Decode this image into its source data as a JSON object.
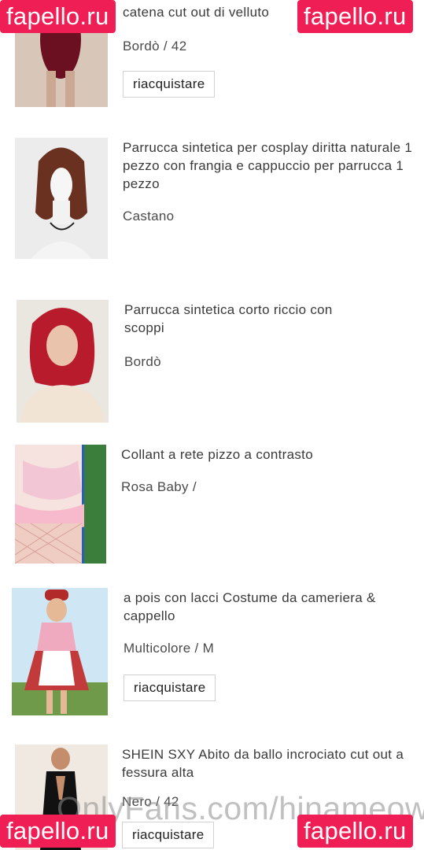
{
  "watermarks": {
    "badge_text": "fapello.ru",
    "site_text": "OnlyFans.com/hinameow",
    "badge_color": "#ef1e54"
  },
  "items": [
    {
      "title": "catena cut out di velluto",
      "variant": "Bordò / 42",
      "rebuy_label": "riacquistare",
      "thumb_colors": [
        "#d8c6b8",
        "#6b1020"
      ]
    },
    {
      "title": "Parrucca sintetica per cosplay diritta naturale 1 pezzo con frangia e cappuccio per parrucca 1 pezzo",
      "variant": "Castano",
      "thumb_colors": [
        "#ececec",
        "#6a3020"
      ]
    },
    {
      "title": "Parrucca sintetica corto riccio con scoppi",
      "variant": "Bordò",
      "thumb_colors": [
        "#eae6e0",
        "#b81c2c"
      ]
    },
    {
      "title": "Collant a rete pizzo a contrasto",
      "variant": "Rosa Baby /",
      "thumb_colors": [
        "#f3c6d6",
        "#2a5fb8"
      ]
    },
    {
      "title": "a pois con lacci Costume da cameriera & cappello",
      "variant": "Multicolore / M",
      "rebuy_label": "riacquistare",
      "thumb_colors": [
        "#cfe6f5",
        "#c23a3a"
      ]
    },
    {
      "title": "SHEIN SXY Abito da ballo incrociato cut out a fessura alta",
      "variant": "Nero / 42",
      "rebuy_label": "riacquistare",
      "thumb_colors": [
        "#efe9e1",
        "#111111"
      ]
    }
  ]
}
